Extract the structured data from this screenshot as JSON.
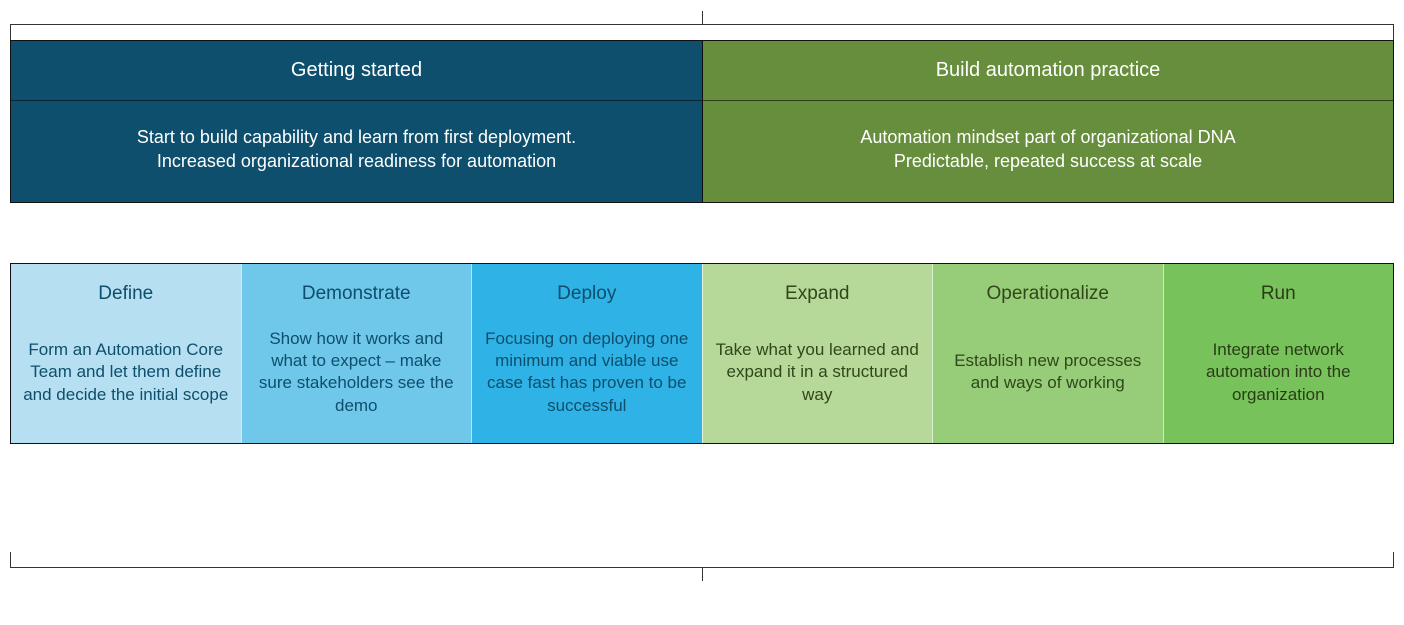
{
  "phases": {
    "left": {
      "title": "Getting started",
      "desc_line1": "Start to build capability and learn from first deployment.",
      "desc_line2": "Increased organizational readiness for automation"
    },
    "right": {
      "title": "Build automation practice",
      "desc_line1": "Automation mindset part of organizational DNA",
      "desc_line2": "Predictable, repeated success at scale"
    }
  },
  "steps": [
    {
      "title": "Define",
      "desc": "Form an Automation Core Team and let them define and decide the initial scope"
    },
    {
      "title": "Demonstrate",
      "desc": "Show how it works and what to expect – make sure stakeholders see the demo"
    },
    {
      "title": "Deploy",
      "desc": "Focusing on deploying one minimum and viable use case fast has proven to be successful"
    },
    {
      "title": "Expand",
      "desc": "Take what you learned and expand it in a structured way"
    },
    {
      "title": "Operationalize",
      "desc": "Establish new processes and ways of working"
    },
    {
      "title": "Run",
      "desc": "Integrate network automation into the organization"
    }
  ]
}
